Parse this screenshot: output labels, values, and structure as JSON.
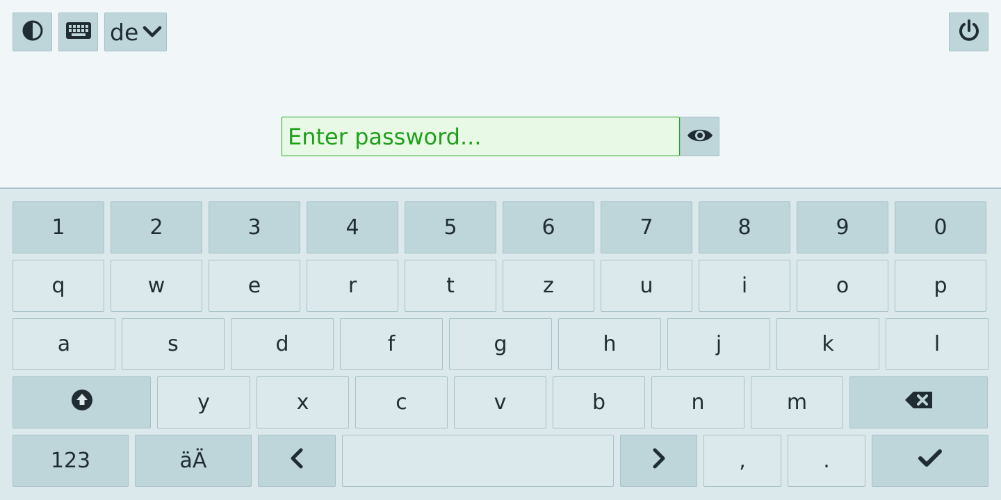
{
  "topbar": {
    "contrast_icon": "contrast-icon",
    "keyboard_icon": "keyboard-icon",
    "layout_label": "de",
    "layout_caret_icon": "chevron-down-icon",
    "power_icon": "power-icon"
  },
  "password": {
    "placeholder": "Enter password...",
    "value": "",
    "toggle_icon": "eye-icon"
  },
  "keyboard": {
    "number_row": [
      "1",
      "2",
      "3",
      "4",
      "5",
      "6",
      "7",
      "8",
      "9",
      "0"
    ],
    "row1": [
      "q",
      "w",
      "e",
      "r",
      "t",
      "z",
      "u",
      "i",
      "o",
      "p"
    ],
    "row2": [
      "a",
      "s",
      "d",
      "f",
      "g",
      "h",
      "j",
      "k",
      "l"
    ],
    "row3": [
      "y",
      "x",
      "c",
      "v",
      "b",
      "n",
      "m"
    ],
    "shift_icon": "shift-icon",
    "backspace_icon": "backspace-icon",
    "mode_label": "123",
    "umlaut_label": "äÄ",
    "left_icon": "chevron-left-icon",
    "right_icon": "chevron-right-icon",
    "comma": ",",
    "period": ".",
    "enter_icon": "check-icon"
  },
  "colors": {
    "background": "#f1f7f8",
    "keyboard_bg": "#dbe8ec",
    "key_dark": "#bed5da",
    "accent_green": "#21a61d",
    "field_bg": "#e8f9e6"
  }
}
